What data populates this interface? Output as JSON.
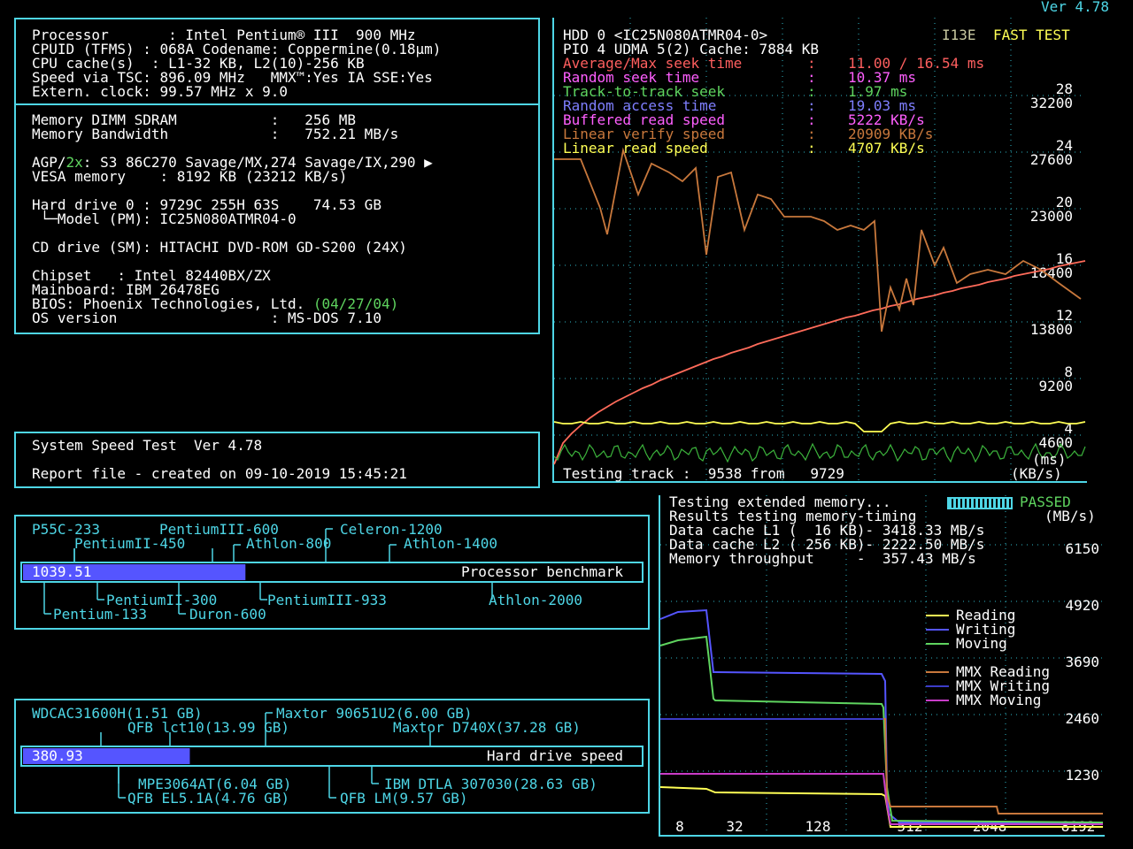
{
  "version": "Ver 4.78",
  "sysinfo": {
    "processor": "Processor       : Intel Pentium® III  900 MHz",
    "cpuid": "CPUID (TFMS) : 068A Codename: Coppermine(0.18µm)",
    "cache": "CPU cache(s)  : L1-32 KB, L2(10)-256 KB",
    "speed": "Speed via TSC: 896.09 MHz   MMX™:Yes IA SSE:Yes",
    "extclk": "Extern. clock: 99.57 MHz x 9.0",
    "memory": "Memory DIMM SDRAM           :   256 MB",
    "bandwidth": "Memory Bandwidth            :   752.21 MB/s",
    "agp_prefix": "AGP/",
    "agp_rate": "2x",
    "agp_rest": ": S3 86C270 Savage/MX,274 Savage/IX,290 ▶",
    "vesa": "VESA memory    : 8192 KB (23212 KB/s)",
    "hdd0": "Hard drive 0 : 9729C 255H 63S    74.53 GB",
    "hdd0model": " └─Model (PM): IC25N080ATMR04-0",
    "cd": "CD drive (SM): HITACHI DVD-ROM GD-S200 (24X)",
    "chipset": "Chipset   : Intel 82440BX/ZX",
    "mainboard": "Mainboard: IBM 26478EG",
    "bios": "BIOS: Phoenix Technologies, Ltd. ",
    "bios_date": "(04/27/04)",
    "os": "OS version                  : MS-DOS 7.10"
  },
  "report": {
    "line1": "System Speed Test  Ver 4.78",
    "line2": "Report file - created on 09-10-2019 15:45:21"
  },
  "hdd": {
    "header": "HDD 0 <IC25N080ATMR04-0>",
    "mode": "I13E",
    "fast_test": "FAST TEST",
    "pio": "PIO 4 UDMA 5(2) Cache: 7884 KB",
    "metrics": [
      {
        "label": "Average/Max seek time",
        "value": "11.00 / 16.54 ms",
        "color": "#ff5f5f"
      },
      {
        "label": "Random seek time",
        "value": "10.37 ms",
        "color": "#ff5fff"
      },
      {
        "label": "Track-to-track seek",
        "value": "1.97 ms",
        "color": "#5fd45f"
      },
      {
        "label": "Random access time",
        "value": "19.03 ms",
        "color": "#7f7fff"
      },
      {
        "label": "Buffered read speed",
        "value": "5222 KB/s",
        "color": "#ff5fff"
      },
      {
        "label": "Linear verify speed",
        "value": "20909 KB/s",
        "color": "#c8783c"
      },
      {
        "label": "Linear read speed",
        "value": "4707 KB/s",
        "color": "#ffff55"
      }
    ],
    "ms_ticks": [
      "28",
      "24",
      "20",
      "16",
      "12",
      "8",
      "4"
    ],
    "kb_ticks": [
      "32200",
      "27600",
      "23000",
      "18400",
      "13800",
      "9200",
      "4600"
    ],
    "unit_ms": "(ms)",
    "unit_kb": "(KB/s)",
    "testing": "Testing track :  9538 from   9729"
  },
  "memtest": {
    "line1": "Testing extended memory...",
    "passed": "PASSED",
    "line2": "Results testing memory-timing",
    "unit": "(MB/s)",
    "l1": "Data cache L1 (  16 KB)- 3418.33 MB/s",
    "l2": "Data cache L2 ( 256 KB)- 2222.50 MB/s",
    "mem": "Memory throughput     -  357.43 MB/s",
    "y_ticks": [
      "6150",
      "4920",
      "3690",
      "2460",
      "1230"
    ],
    "x_ticks": [
      "8",
      "32",
      "128",
      "512",
      "2048",
      "8192"
    ],
    "legend": [
      {
        "label": "Reading",
        "color": "#ffff55"
      },
      {
        "label": "Writing",
        "color": "#5555ff"
      },
      {
        "label": "Moving",
        "color": "#5fd45f"
      },
      {
        "label": "MMX Reading",
        "color": "#c8783c"
      },
      {
        "label": "MMX Writing",
        "color": "#3c3cc8"
      },
      {
        "label": "MMX Moving",
        "color": "#c83cc8"
      }
    ]
  },
  "cpu_bench": {
    "value": "1039.51",
    "value_fraction": 0.36,
    "caption": "Processor benchmark",
    "top_refs": [
      "P55C-233",
      "PentiumIII-600",
      "Celeron-1200",
      "PentiumII-450",
      "Athlon-800",
      "Athlon-1400"
    ],
    "bottom_refs": [
      "PentiumII-300",
      "PentiumIII-933",
      "Athlon-2000",
      "Pentium-133",
      "Duron-600"
    ]
  },
  "hdd_bench": {
    "value": "380.93",
    "value_fraction": 0.27,
    "caption": "Hard drive speed",
    "top_refs": [
      "WDCAC31600H(1.51 GB)",
      "Maxtor 90651U2(6.00 GB)",
      "QFB lct10(13.99 GB)",
      "Maxtor D740X(37.28 GB)"
    ],
    "bottom_refs": [
      "MPE3064AT(6.04 GB)",
      "IBM DTLA 307030(28.63 GB)",
      "QFB EL5.1A(4.76 GB)",
      "QFB LM(9.57 GB)"
    ]
  },
  "colors": {
    "frame": "#4ed6e6",
    "bar": "#5555ff",
    "grid": "#2fb8c8"
  }
}
